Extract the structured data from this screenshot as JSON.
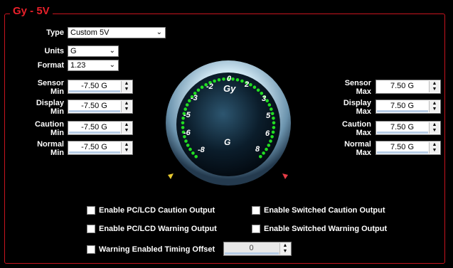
{
  "title": "Gy - 5V",
  "type": {
    "label": "Type",
    "value": "Custom 5V"
  },
  "units": {
    "label": "Units",
    "value": "G"
  },
  "format": {
    "label": "Format",
    "value": "1.23"
  },
  "left_fields": [
    {
      "label1": "Sensor",
      "label2": "Min",
      "value": "-7.50 G"
    },
    {
      "label1": "Display",
      "label2": "Min",
      "value": "-7.50 G"
    },
    {
      "label1": "Caution",
      "label2": "Min",
      "value": "-7.50 G"
    },
    {
      "label1": "Normal",
      "label2": "Min",
      "value": "-7.50 G"
    }
  ],
  "right_fields": [
    {
      "label1": "Sensor",
      "label2": "Max",
      "value": "7.50 G"
    },
    {
      "label1": "Display",
      "label2": "Max",
      "value": "7.50 G"
    },
    {
      "label1": "Caution",
      "label2": "Max",
      "value": "7.50 G"
    },
    {
      "label1": "Normal",
      "label2": "Max",
      "value": "7.50 G"
    }
  ],
  "gauge": {
    "label": "Gy",
    "unit": "G",
    "left_ticks": [
      "-2",
      "-3",
      "-5",
      "-6",
      "-8"
    ],
    "right_ticks": [
      "0",
      "2",
      "3",
      "5",
      "6",
      "8"
    ],
    "led_color": "#22dd22",
    "caution_marker_color": "#e6c830",
    "warning_marker_color": "#e63c46"
  },
  "checkboxes": {
    "pc_caution": "Enable PC/LCD Caution Output",
    "sw_caution": "Enable Switched Caution Output",
    "pc_warning": "Enable PC/LCD Warning Output",
    "sw_warning": "Enable Switched Warning Output",
    "timing_offset": "Warning Enabled Timing Offset"
  },
  "timing_offset_value": "0",
  "accent_color": "#c8141e"
}
